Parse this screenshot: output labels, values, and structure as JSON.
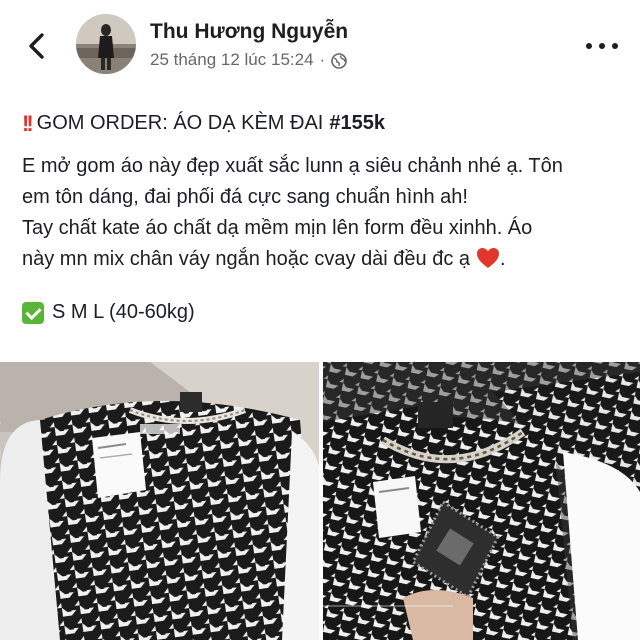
{
  "post": {
    "author": "Thu Hương Nguyễn",
    "timestamp": "25 tháng 12 lúc 15:24",
    "separator": "·",
    "privacy_icon": "globe-icon",
    "headline": {
      "emoji": "!!",
      "text": "GOM ORDER: ÁO DẠ KÈM ĐAI",
      "price": "#155k"
    },
    "body_lines": [
      "E mở gom áo này đẹp xuất sắc lunn ạ siêu chảnh nhé ạ. Tôn",
      "em tôn dáng, đai phối đá cực sang chuẩn hình ah!",
      "Tay chất kate áo chất dạ mềm mịn lên form đều xinhh. Áo",
      "này mn mix chân váy ngắn hoặc cvay dài đều đc ạ"
    ],
    "sizes": "S M L (40-60kg)"
  },
  "colors": {
    "text": "#1c1e21",
    "meta": "#65676b",
    "heart": "#e0362c",
    "check": "#59b535"
  }
}
